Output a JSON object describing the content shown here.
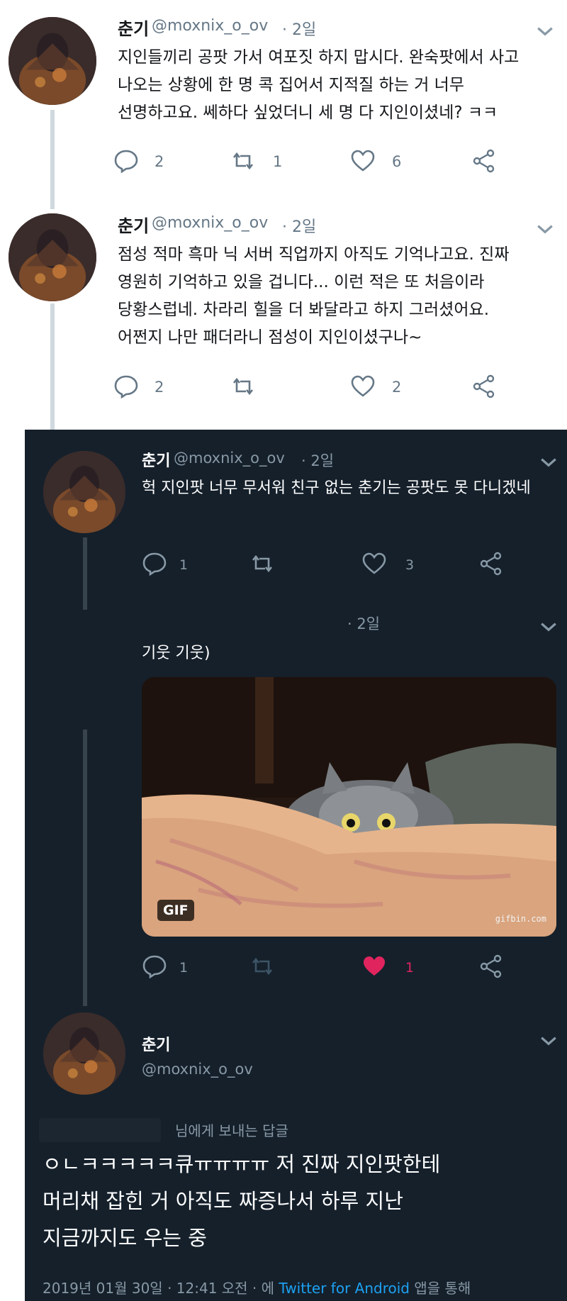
{
  "tweets_light": [
    {
      "name": "춘기",
      "handle": "@moxnix_o_ov",
      "time": "· 2일",
      "lines": [
        "지인들끼리 공팟 가서 여포짓 하지 맙시다. 완숙팟에서 사고",
        "나오는 상황에 한 명 콕 집어서 지적질 하는 거 너무",
        "선명하고요. 쎄하다 싶었더니 세 명 다 지인이셨네? ㅋㅋ"
      ],
      "replies": "2",
      "retweets": "1",
      "likes": "6"
    },
    {
      "name": "춘기",
      "handle": "@moxnix_o_ov",
      "time": "· 2일",
      "lines": [
        "점성 적마 흑마 닉 서버 직업까지 아직도 기억나고요. 진짜",
        "영원히 기억하고 있을 겁니다... 이런 적은 또 처음이라",
        "당황스럽네. 차라리 힐을 더 봐달라고 하지 그러셨어요.",
        "어쩐지 나만 패더라니 점성이 지인이셨구나~"
      ],
      "replies": "2",
      "retweets": "",
      "likes": "2"
    }
  ],
  "dark_tweet": {
    "name": "춘기",
    "handle": "@moxnix_o_ov",
    "time": "· 2일",
    "text": "헉 지인팟 너무 무서워 친구 없는 춘기는 공팟도 못 다니겠네",
    "replies": "1",
    "retweets": "",
    "likes": "3"
  },
  "gif_tweet": {
    "time": "· 2일",
    "text": "기웃 기웃)",
    "gif_badge": "GIF",
    "gif_watermark": "gifbin.com",
    "replies": "1",
    "retweets": "",
    "likes": "1",
    "liked": true
  },
  "main_tweet": {
    "name": "춘기",
    "handle": "@moxnix_o_ov",
    "reply_to": "님에게 보내는 답글",
    "lines": [
      "ㅇㄴㅋㅋㅋㅋㅋ큐ㅠㅠㅠㅠ 저 진짜 지인팟한테",
      "머리채 잡힌 거 아직도 짜증나서 하루 지난",
      "지금까지도 우는  중"
    ],
    "meta_prefix": "2019년 01월 30일 · 12:41 오전 · 에",
    "meta_link": "Twitter for Android",
    "meta_suffix": "앱을 통해"
  },
  "colors": {
    "light_bg": "#ffffff",
    "dark_bg": "#15202b",
    "link": "#1da1f2",
    "like_active": "#e0245e"
  },
  "icons": [
    "reply-icon",
    "retweet-icon",
    "like-icon",
    "share-icon",
    "chevron-down-icon"
  ]
}
